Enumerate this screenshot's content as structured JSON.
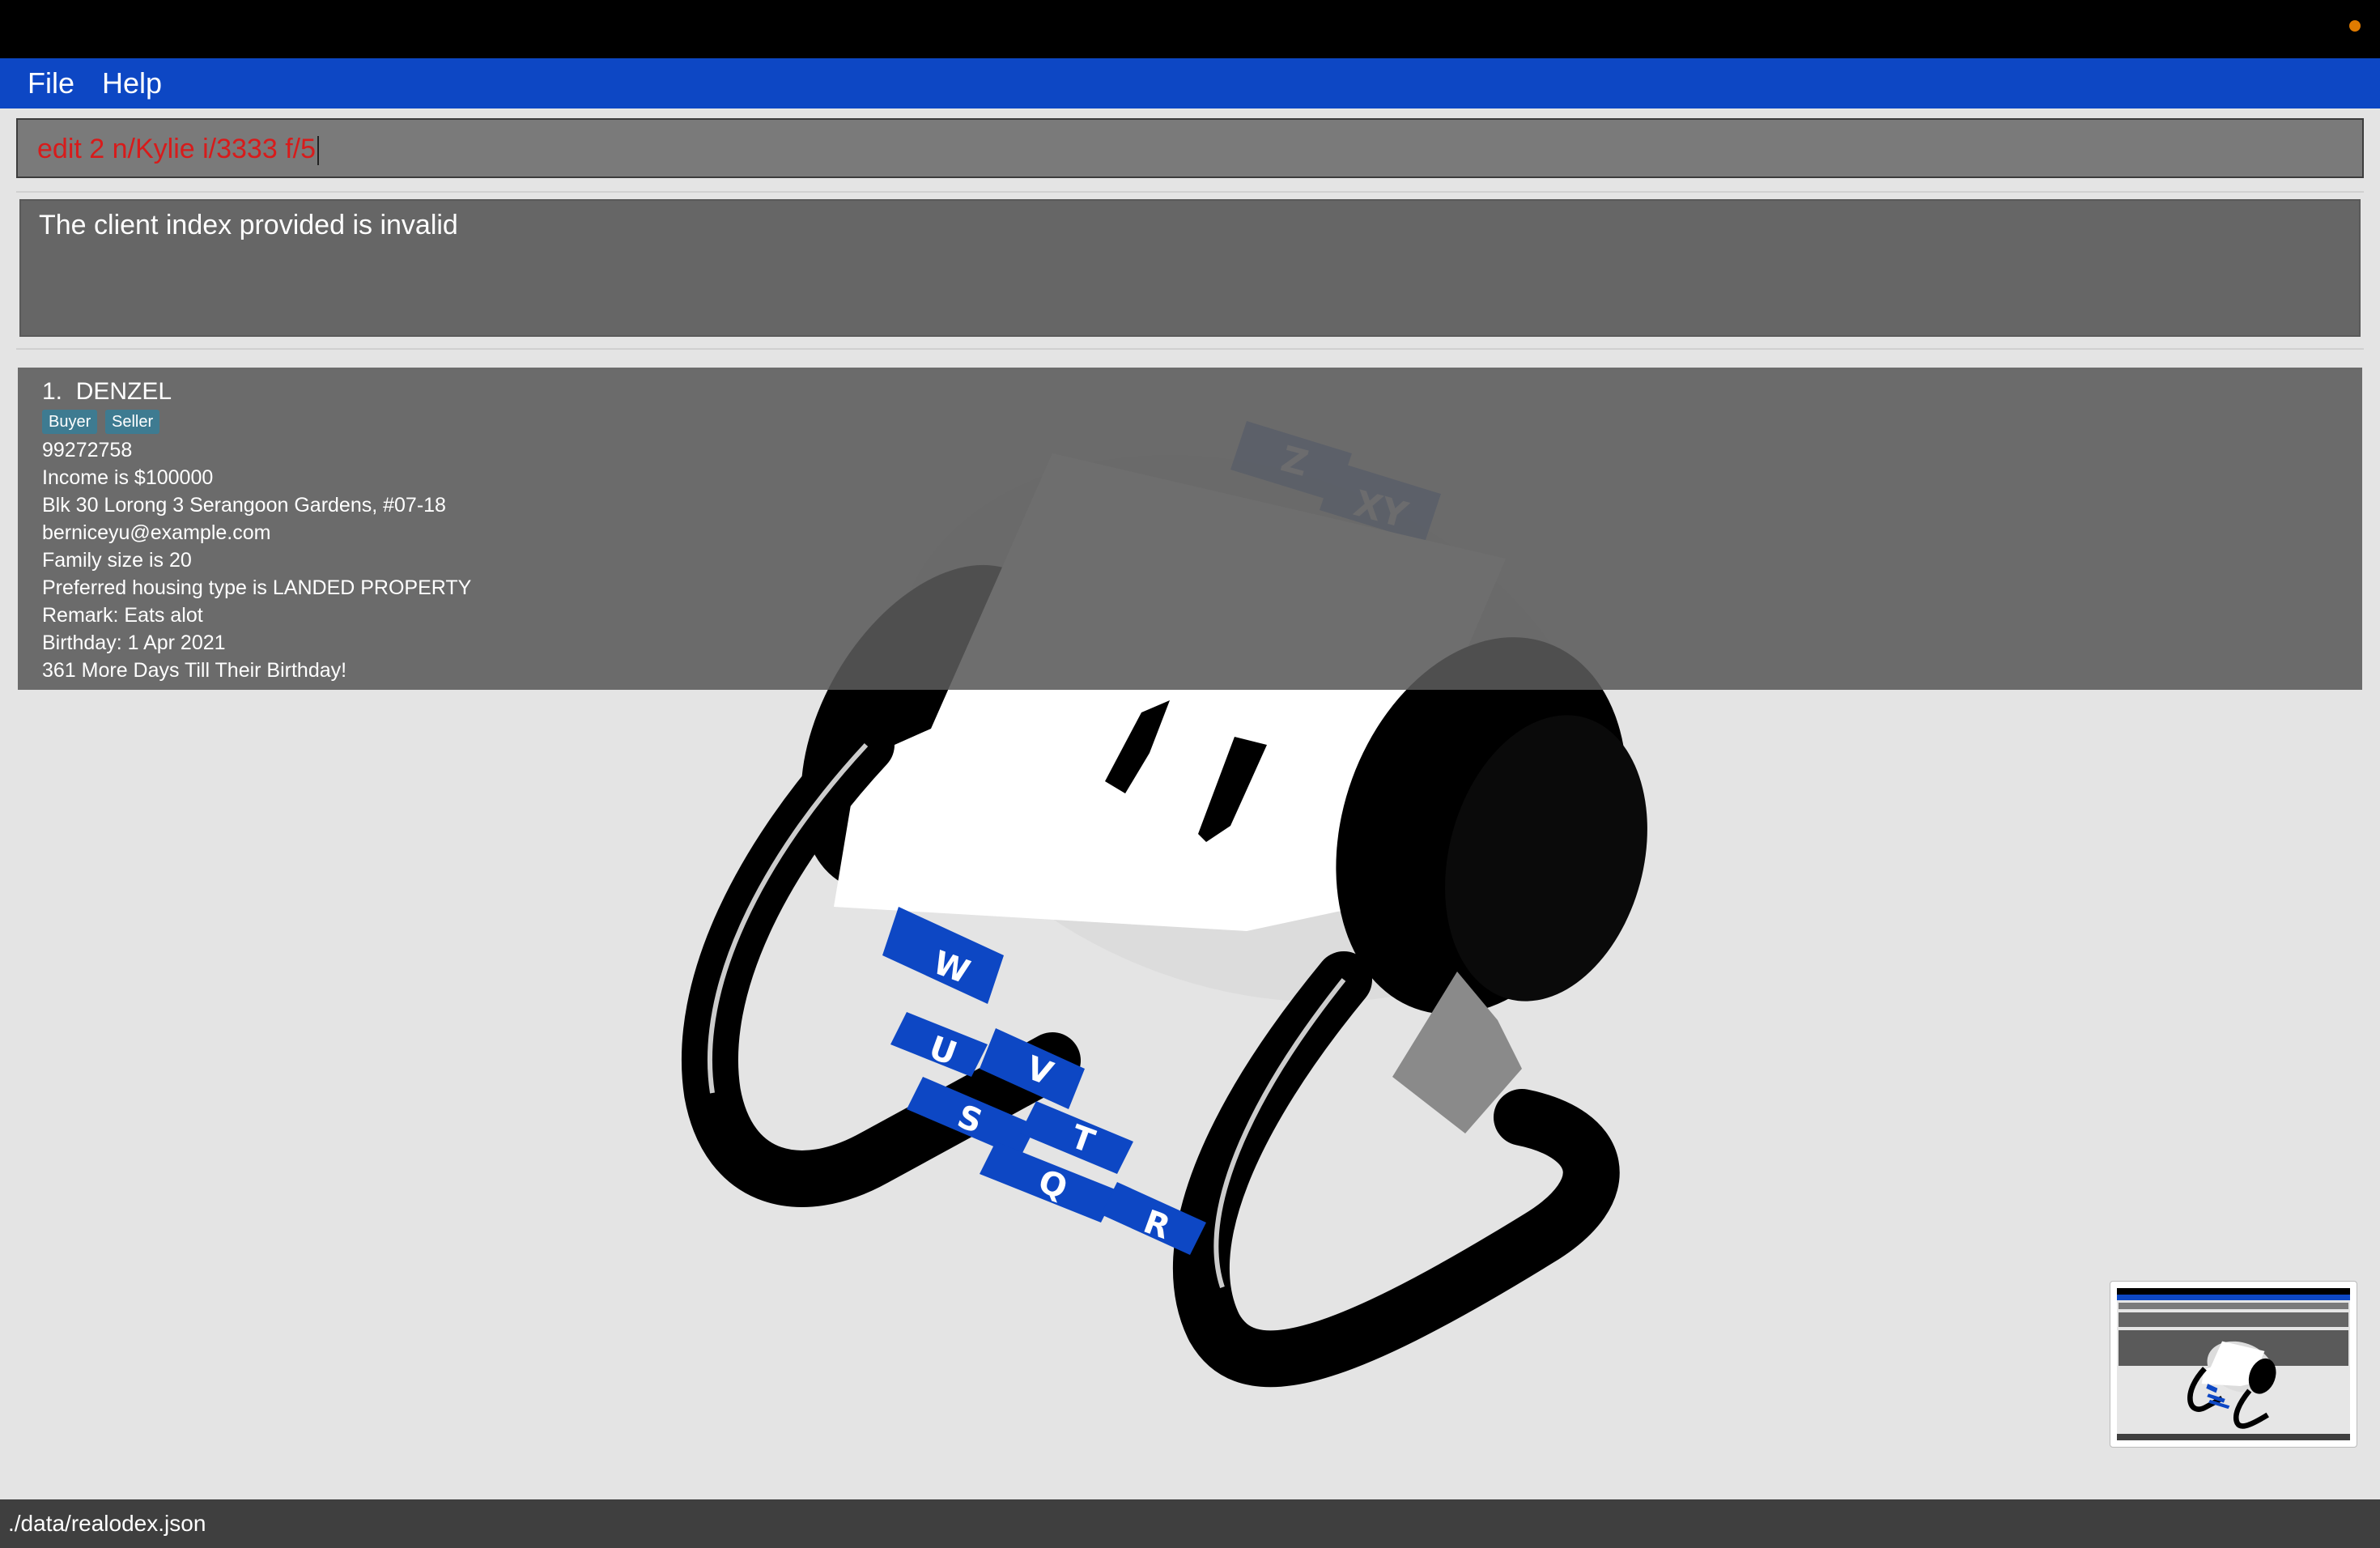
{
  "window": {
    "indicator_color": "#e07b00"
  },
  "menu": {
    "file_label": "File",
    "help_label": "Help"
  },
  "command": {
    "value": "edit 2 n/Kylie i/3333 f/5",
    "text_color": "#d81b1b"
  },
  "result": {
    "message": "The client index provided is invalid"
  },
  "client_list": [
    {
      "index": "1.",
      "name": "DENZEL",
      "tags": [
        "Buyer",
        "Seller"
      ],
      "phone": "99272758",
      "income": "Income is $100000",
      "address": "Blk 30 Lorong 3 Serangoon Gardens, #07-18",
      "email": "berniceyu@example.com",
      "family": "Family size is 20",
      "housing": "Preferred housing type is LANDED PROPERTY",
      "remark": "Remark: Eats alot",
      "birthday": "Birthday: 1 Apr 2021",
      "countdown": "361 More Days Till Their Birthday!"
    }
  ],
  "logo": {
    "name": "rolodex-logo",
    "letters": [
      "Z",
      "XY",
      "W",
      "U",
      "V",
      "S",
      "T",
      "Q",
      "R"
    ],
    "tab_color": "#0d47c4"
  },
  "status": {
    "path": "./data/realodex.json"
  }
}
